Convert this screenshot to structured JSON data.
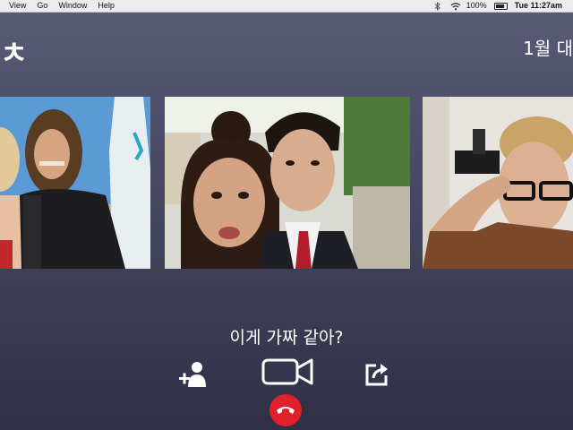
{
  "menubar": {
    "items": [
      "View",
      "Go",
      "Window",
      "Help"
    ],
    "battery": "100%",
    "clock": "Tue 11:27am"
  },
  "header": {
    "title_glyph": "ㅊ",
    "date": "1월 대"
  },
  "subtitle": "이게 가짜 같아?",
  "controls": {
    "add_person_icon": "add-person-icon",
    "video_icon": "video-camera-icon",
    "share_icon": "share-icon",
    "end_call_icon": "end-call-icon"
  },
  "colors": {
    "end_call": "#e0202a",
    "background": "#4a4b66"
  }
}
